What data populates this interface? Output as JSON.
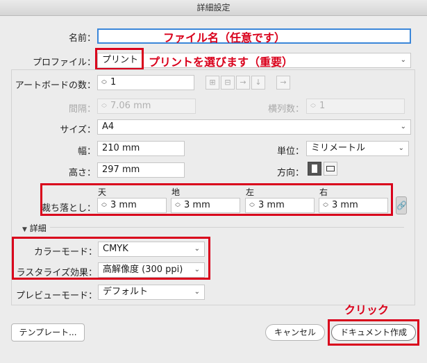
{
  "window": {
    "title": "詳細設定"
  },
  "name": {
    "label": "名前：",
    "value": ""
  },
  "profile": {
    "label": "プロファイル：",
    "value": "プリント"
  },
  "artboards": {
    "label": "アートボードの数：",
    "value": "1"
  },
  "spacing": {
    "label": "間隔：",
    "value": "7.06 mm"
  },
  "columns": {
    "label": "横列数：",
    "value": "1"
  },
  "size": {
    "label": "サイズ：",
    "value": "A4"
  },
  "width": {
    "label": "幅：",
    "value": "210 mm"
  },
  "units": {
    "label": "単位：",
    "value": "ミリメートル"
  },
  "height": {
    "label": "高さ：",
    "value": "297 mm"
  },
  "orientation": {
    "label": "方向："
  },
  "bleed": {
    "label": "裁ち落とし：",
    "top": {
      "label": "天",
      "value": "3 mm"
    },
    "bottom": {
      "label": "地",
      "value": "3 mm"
    },
    "left": {
      "label": "左",
      "value": "3 mm"
    },
    "right": {
      "label": "右",
      "value": "3 mm"
    }
  },
  "advanced": {
    "label": "詳細"
  },
  "color_mode": {
    "label": "カラーモード：",
    "value": "CMYK"
  },
  "raster": {
    "label": "ラスタライズ効果：",
    "value": "高解像度 (300 ppi)"
  },
  "preview": {
    "label": "プレビューモード：",
    "value": "デフォルト"
  },
  "buttons": {
    "templates": "テンプレート...",
    "cancel": "キャンセル",
    "create": "ドキュメント作成"
  },
  "annotations": {
    "name_note": "ファイル名（任意です）",
    "profile_note": "プリントを選びます（重要）",
    "click_note": "クリック"
  },
  "colors": {
    "annotation": "#d9001b",
    "name_field_border": "#3a86d9"
  }
}
